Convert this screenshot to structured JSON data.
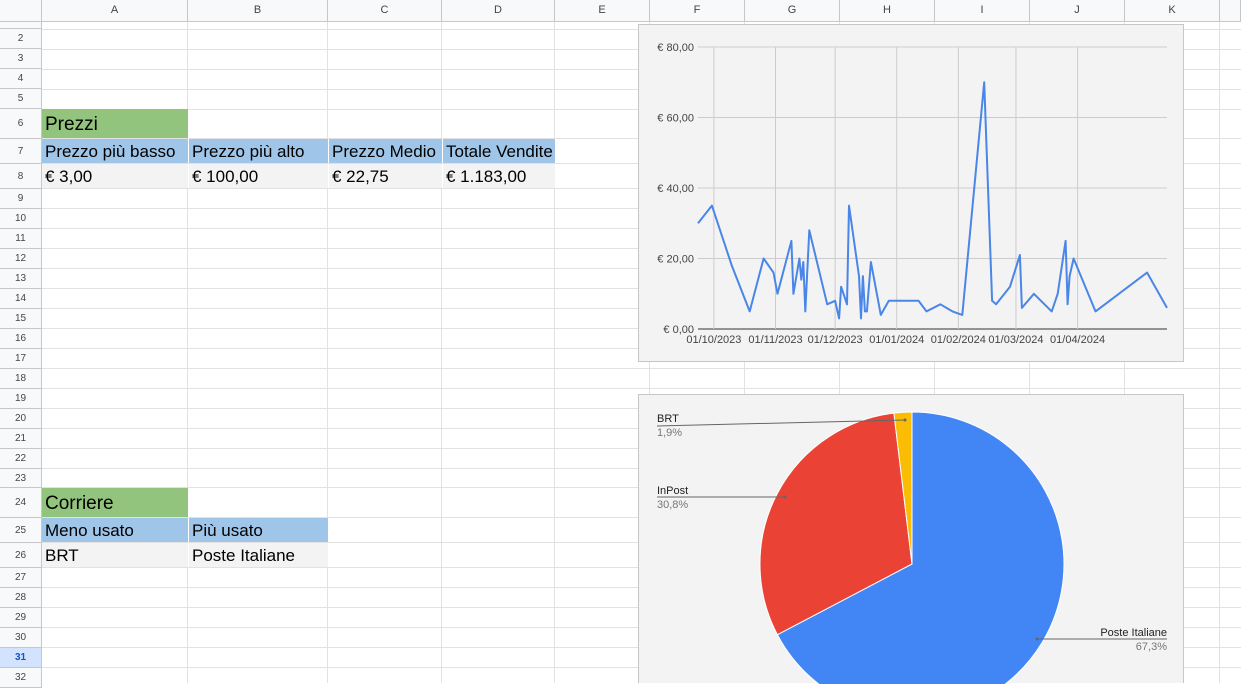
{
  "columns": [
    "A",
    "B",
    "C",
    "D",
    "E",
    "F",
    "G",
    "H",
    "I",
    "J",
    "K"
  ],
  "rows": [
    "2",
    "3",
    "4",
    "5",
    "6",
    "7",
    "8",
    "9",
    "10",
    "11",
    "12",
    "13",
    "14",
    "15",
    "16",
    "17",
    "18",
    "19",
    "20",
    "21",
    "22",
    "23",
    "24",
    "25",
    "26",
    "27",
    "28",
    "29",
    "30",
    "31",
    "32"
  ],
  "selected_row": "31",
  "prezzi": {
    "title": "Prezzi",
    "headers": [
      "Prezzo più basso",
      "Prezzo più alto",
      "Prezzo Medio",
      "Totale Vendite"
    ],
    "values": [
      "€ 3,00",
      "€ 100,00",
      "€ 22,75",
      "€ 1.183,00"
    ]
  },
  "corriere": {
    "title": "Corriere",
    "headers": [
      "Meno usato",
      "Più usato"
    ],
    "values": [
      "BRT",
      "Poste Italiane"
    ]
  },
  "chart_data": [
    {
      "type": "line",
      "title": "",
      "y_ticks": [
        "€ 0,00",
        "€ 20,00",
        "€ 40,00",
        "€ 60,00",
        "€ 80,00"
      ],
      "x_ticks": [
        "01/10/2023",
        "01/11/2023",
        "01/12/2023",
        "01/01/2024",
        "01/02/2024",
        "01/03/2024",
        "01/04/2024"
      ],
      "ylim": [
        0,
        80
      ],
      "grid": true,
      "line_color": "#4a86e8",
      "series": [
        {
          "values": [
            {
              "x": "2023-09-23",
              "y": 30
            },
            {
              "x": "2023-09-30",
              "y": 35
            },
            {
              "x": "2023-10-10",
              "y": 18
            },
            {
              "x": "2023-10-19",
              "y": 5
            },
            {
              "x": "2023-10-26",
              "y": 20
            },
            {
              "x": "2023-10-31",
              "y": 16
            },
            {
              "x": "2023-11-02",
              "y": 10
            },
            {
              "x": "2023-11-09",
              "y": 25
            },
            {
              "x": "2023-11-10",
              "y": 10
            },
            {
              "x": "2023-11-13",
              "y": 20
            },
            {
              "x": "2023-11-14",
              "y": 14
            },
            {
              "x": "2023-11-15",
              "y": 19
            },
            {
              "x": "2023-11-16",
              "y": 5
            },
            {
              "x": "2023-11-18",
              "y": 28
            },
            {
              "x": "2023-11-27",
              "y": 7
            },
            {
              "x": "2023-12-01",
              "y": 8
            },
            {
              "x": "2023-12-03",
              "y": 3
            },
            {
              "x": "2023-12-04",
              "y": 12
            },
            {
              "x": "2023-12-07",
              "y": 7
            },
            {
              "x": "2023-12-08",
              "y": 35
            },
            {
              "x": "2023-12-13",
              "y": 15
            },
            {
              "x": "2023-12-14",
              "y": 3
            },
            {
              "x": "2023-12-15",
              "y": 15
            },
            {
              "x": "2023-12-16",
              "y": 5
            },
            {
              "x": "2023-12-17",
              "y": 5
            },
            {
              "x": "2023-12-19",
              "y": 19
            },
            {
              "x": "2023-12-24",
              "y": 4
            },
            {
              "x": "2023-12-28",
              "y": 8
            },
            {
              "x": "2024-01-05",
              "y": 8
            },
            {
              "x": "2024-01-12",
              "y": 8
            },
            {
              "x": "2024-01-16",
              "y": 5
            },
            {
              "x": "2024-01-23",
              "y": 7
            },
            {
              "x": "2024-01-29",
              "y": 5
            },
            {
              "x": "2024-02-03",
              "y": 4
            },
            {
              "x": "2024-02-14",
              "y": 70
            },
            {
              "x": "2024-02-18",
              "y": 8
            },
            {
              "x": "2024-02-20",
              "y": 7
            },
            {
              "x": "2024-02-27",
              "y": 12
            },
            {
              "x": "2024-03-03",
              "y": 21
            },
            {
              "x": "2024-03-04",
              "y": 6
            },
            {
              "x": "2024-03-10",
              "y": 10
            },
            {
              "x": "2024-03-19",
              "y": 5
            },
            {
              "x": "2024-03-22",
              "y": 10
            },
            {
              "x": "2024-03-26",
              "y": 25
            },
            {
              "x": "2024-03-27",
              "y": 7
            },
            {
              "x": "2024-03-28",
              "y": 15
            },
            {
              "x": "2024-03-30",
              "y": 20
            },
            {
              "x": "2024-04-10",
              "y": 5
            },
            {
              "x": "2024-05-06",
              "y": 16
            },
            {
              "x": "2024-05-16",
              "y": 6
            }
          ]
        }
      ]
    },
    {
      "type": "pie",
      "title": "",
      "slices": [
        {
          "label": "Poste Italiane",
          "value": 67.3,
          "pct": "67,3%",
          "color": "#4285f4"
        },
        {
          "label": "InPost",
          "value": 30.8,
          "pct": "30,8%",
          "color": "#ea4335"
        },
        {
          "label": "BRT",
          "value": 1.9,
          "pct": "1,9%",
          "color": "#fbbc04"
        }
      ]
    }
  ]
}
